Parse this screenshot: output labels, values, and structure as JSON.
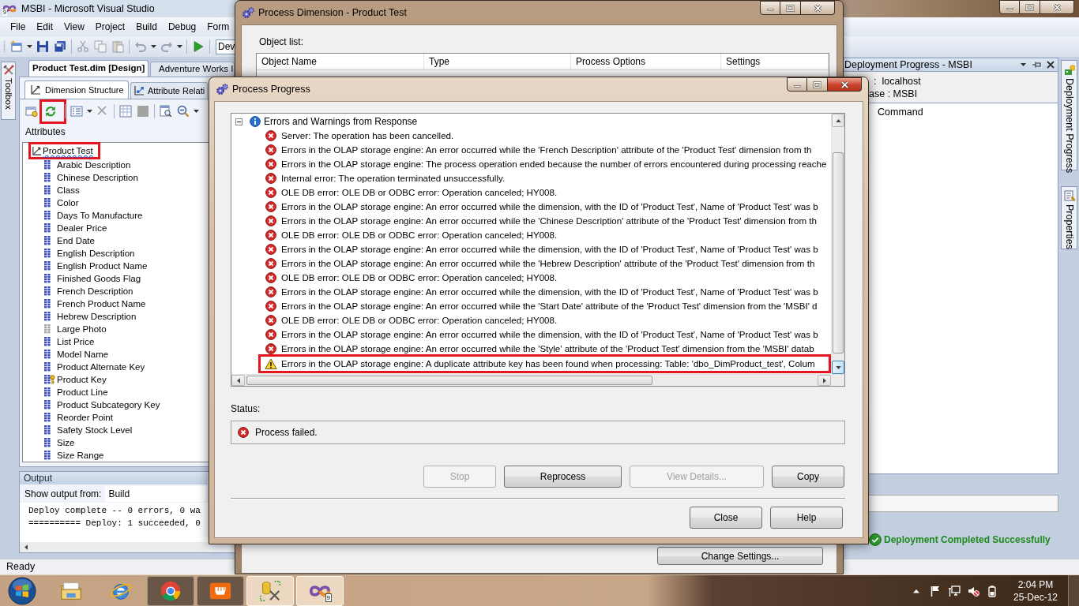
{
  "vs": {
    "title": "MSBI - Microsoft Visual Studio",
    "logo_badge": "9",
    "menu": [
      "File",
      "Edit",
      "View",
      "Project",
      "Build",
      "Debug",
      "Form"
    ],
    "configuration_field": "Dev",
    "toolbox_tab": "Toolbox",
    "document_tabs": [
      {
        "label": "Product Test.dim [Design]",
        "selected": true
      },
      {
        "label": "Adventure Works I",
        "selected": false
      }
    ],
    "designer_tabs": [
      {
        "label": "Dimension Structure",
        "selected": true
      },
      {
        "label": "Attribute Relati",
        "selected": false
      }
    ],
    "designer_toolbar": {
      "process_button_highlighted": true
    },
    "attributes_title": "Attributes",
    "dimension": {
      "label": "Product Test",
      "has_warning": true,
      "highlighted": true,
      "children": [
        {
          "label": "Arabic Description",
          "kind": "attribute"
        },
        {
          "label": "Chinese Description",
          "kind": "attribute"
        },
        {
          "label": "Class",
          "kind": "attribute"
        },
        {
          "label": "Color",
          "kind": "attribute"
        },
        {
          "label": "Days To Manufacture",
          "kind": "attribute"
        },
        {
          "label": "Dealer Price",
          "kind": "attribute"
        },
        {
          "label": "End Date",
          "kind": "attribute"
        },
        {
          "label": "English Description",
          "kind": "attribute"
        },
        {
          "label": "English Product Name",
          "kind": "attribute"
        },
        {
          "label": "Finished Goods Flag",
          "kind": "attribute"
        },
        {
          "label": "French Description",
          "kind": "attribute"
        },
        {
          "label": "French Product Name",
          "kind": "attribute"
        },
        {
          "label": "Hebrew Description",
          "kind": "attribute"
        },
        {
          "label": "Large Photo",
          "kind": "inactive"
        },
        {
          "label": "List Price",
          "kind": "attribute"
        },
        {
          "label": "Model Name",
          "kind": "attribute"
        },
        {
          "label": "Product Alternate Key",
          "kind": "attribute"
        },
        {
          "label": "Product Key",
          "kind": "key"
        },
        {
          "label": "Product Line",
          "kind": "attribute"
        },
        {
          "label": "Product Subcategory Key",
          "kind": "attribute"
        },
        {
          "label": "Reorder Point",
          "kind": "attribute"
        },
        {
          "label": "Safety Stock Level",
          "kind": "attribute"
        },
        {
          "label": "Size",
          "kind": "attribute"
        },
        {
          "label": "Size Range",
          "kind": "attribute"
        }
      ]
    },
    "output": {
      "title": "Output",
      "source_label": "Show output from:",
      "source": "Build",
      "lines": [
        "Deploy complete -- 0 errors, 0 wa",
        "========== Deploy: 1 succeeded, 0"
      ]
    },
    "deployment": {
      "title": "Deployment Progress - MSBI",
      "server_line": ":  localhost",
      "database_line": "ase : MSBI",
      "items": [
        "Command"
      ],
      "result": "Deployment Completed Successfully"
    },
    "side_tabs": [
      "Deployment Progress",
      "Properties"
    ],
    "status_bar": "Ready"
  },
  "process_dimension": {
    "title": "Process Dimension - Product Test",
    "object_list_label": "Object list:",
    "columns": [
      "Object Name",
      "Type",
      "Process Options",
      "Settings"
    ],
    "change_settings_button": "Change Settings..."
  },
  "process_progress": {
    "title": "Process Progress",
    "log": {
      "label": "Errors and Warnings from Response",
      "expanded": true,
      "children": [
        {
          "kind": "error",
          "highlighted": false,
          "text": "Server: The operation has been cancelled."
        },
        {
          "kind": "error",
          "highlighted": false,
          "text": "Errors in the OLAP storage engine: An error occurred while the 'French Description' attribute of the 'Product Test' dimension from th"
        },
        {
          "kind": "error",
          "highlighted": false,
          "text": "Errors in the OLAP storage engine: The process operation ended because the number of errors encountered during processing reache"
        },
        {
          "kind": "error",
          "highlighted": false,
          "text": "Internal error: The operation terminated unsuccessfully."
        },
        {
          "kind": "error",
          "highlighted": false,
          "text": "OLE DB error: OLE DB or ODBC error: Operation canceled; HY008."
        },
        {
          "kind": "error",
          "highlighted": false,
          "text": "Errors in the OLAP storage engine: An error occurred while the dimension, with the ID of 'Product Test', Name of 'Product Test' was b"
        },
        {
          "kind": "error",
          "highlighted": false,
          "text": "Errors in the OLAP storage engine: An error occurred while the 'Chinese Description' attribute of the 'Product Test' dimension from th"
        },
        {
          "kind": "error",
          "highlighted": false,
          "text": "OLE DB error: OLE DB or ODBC error: Operation canceled; HY008."
        },
        {
          "kind": "error",
          "highlighted": false,
          "text": "Errors in the OLAP storage engine: An error occurred while the dimension, with the ID of 'Product Test', Name of 'Product Test' was b"
        },
        {
          "kind": "error",
          "highlighted": false,
          "text": "Errors in the OLAP storage engine: An error occurred while the 'Hebrew Description' attribute of the 'Product Test' dimension from th"
        },
        {
          "kind": "error",
          "highlighted": false,
          "text": "OLE DB error: OLE DB or ODBC error: Operation canceled; HY008."
        },
        {
          "kind": "error",
          "highlighted": false,
          "text": "Errors in the OLAP storage engine: An error occurred while the dimension, with the ID of 'Product Test', Name of 'Product Test' was b"
        },
        {
          "kind": "error",
          "highlighted": false,
          "text": "Errors in the OLAP storage engine: An error occurred while the 'Start Date' attribute of the 'Product Test' dimension from the 'MSBI' d"
        },
        {
          "kind": "error",
          "highlighted": false,
          "text": "OLE DB error: OLE DB or ODBC error: Operation canceled; HY008."
        },
        {
          "kind": "error",
          "highlighted": false,
          "text": "Errors in the OLAP storage engine: An error occurred while the dimension, with the ID of 'Product Test', Name of 'Product Test' was b"
        },
        {
          "kind": "error",
          "highlighted": false,
          "text": "Errors in the OLAP storage engine: An error occurred while the 'Style' attribute of the 'Product Test' dimension from the 'MSBI' datab"
        },
        {
          "kind": "warning",
          "highlighted": true,
          "text": "Errors in the OLAP storage engine: A duplicate attribute key has been found when processing: Table: 'dbo_DimProduct_test', Colum"
        }
      ]
    },
    "status_label": "Status:",
    "status": {
      "kind": "error",
      "text": "Process failed."
    },
    "buttons": [
      {
        "label": "Stop",
        "disabled": true
      },
      {
        "label": "Reprocess",
        "disabled": false
      },
      {
        "label": "View Details...",
        "disabled": true
      },
      {
        "label": "Copy",
        "disabled": false
      }
    ],
    "footer_buttons": [
      "Close",
      "Help"
    ]
  },
  "taskbar": {
    "items": [
      {
        "running": false,
        "selected": false
      },
      {
        "running": false,
        "selected": false
      },
      {
        "running": true,
        "selected": false
      },
      {
        "running": true,
        "selected": false
      },
      {
        "running": true,
        "selected": true
      },
      {
        "running": true,
        "selected": true,
        "badge": "9"
      }
    ],
    "volume_muted": true,
    "time": "2:04 PM",
    "date": "25-Dec-12"
  }
}
